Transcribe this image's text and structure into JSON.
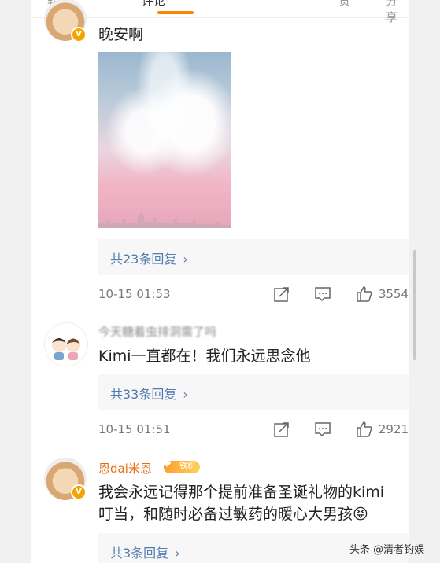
{
  "tabs": [
    "转发",
    "评论",
    "赞",
    "分享"
  ],
  "comments": [
    {
      "text": "晚安啊",
      "replies_label": "共23条回复",
      "time": "10-15 01:53",
      "likes": "3554"
    },
    {
      "username": "今天糖着虫排洞需了吗",
      "text": "Kimi一直都在！我们永远思念他",
      "replies_label": "共33条回复",
      "time": "10-15 01:51",
      "likes": "2921"
    },
    {
      "username": "恩dai米恩",
      "fan_badge": "铁粉",
      "text_line1": "我会永远记得那个提前准备圣诞礼物的kimi",
      "text_line2": "叮当，和随时必备过敏药的暖心大男孩😝",
      "replies_label": "共3条回复"
    }
  ],
  "verified_badge": "V",
  "watermark": "头条 @清者钓娱",
  "colors": {
    "accent": "#ff8200",
    "link": "#507daf",
    "verified": "#f5a300"
  }
}
